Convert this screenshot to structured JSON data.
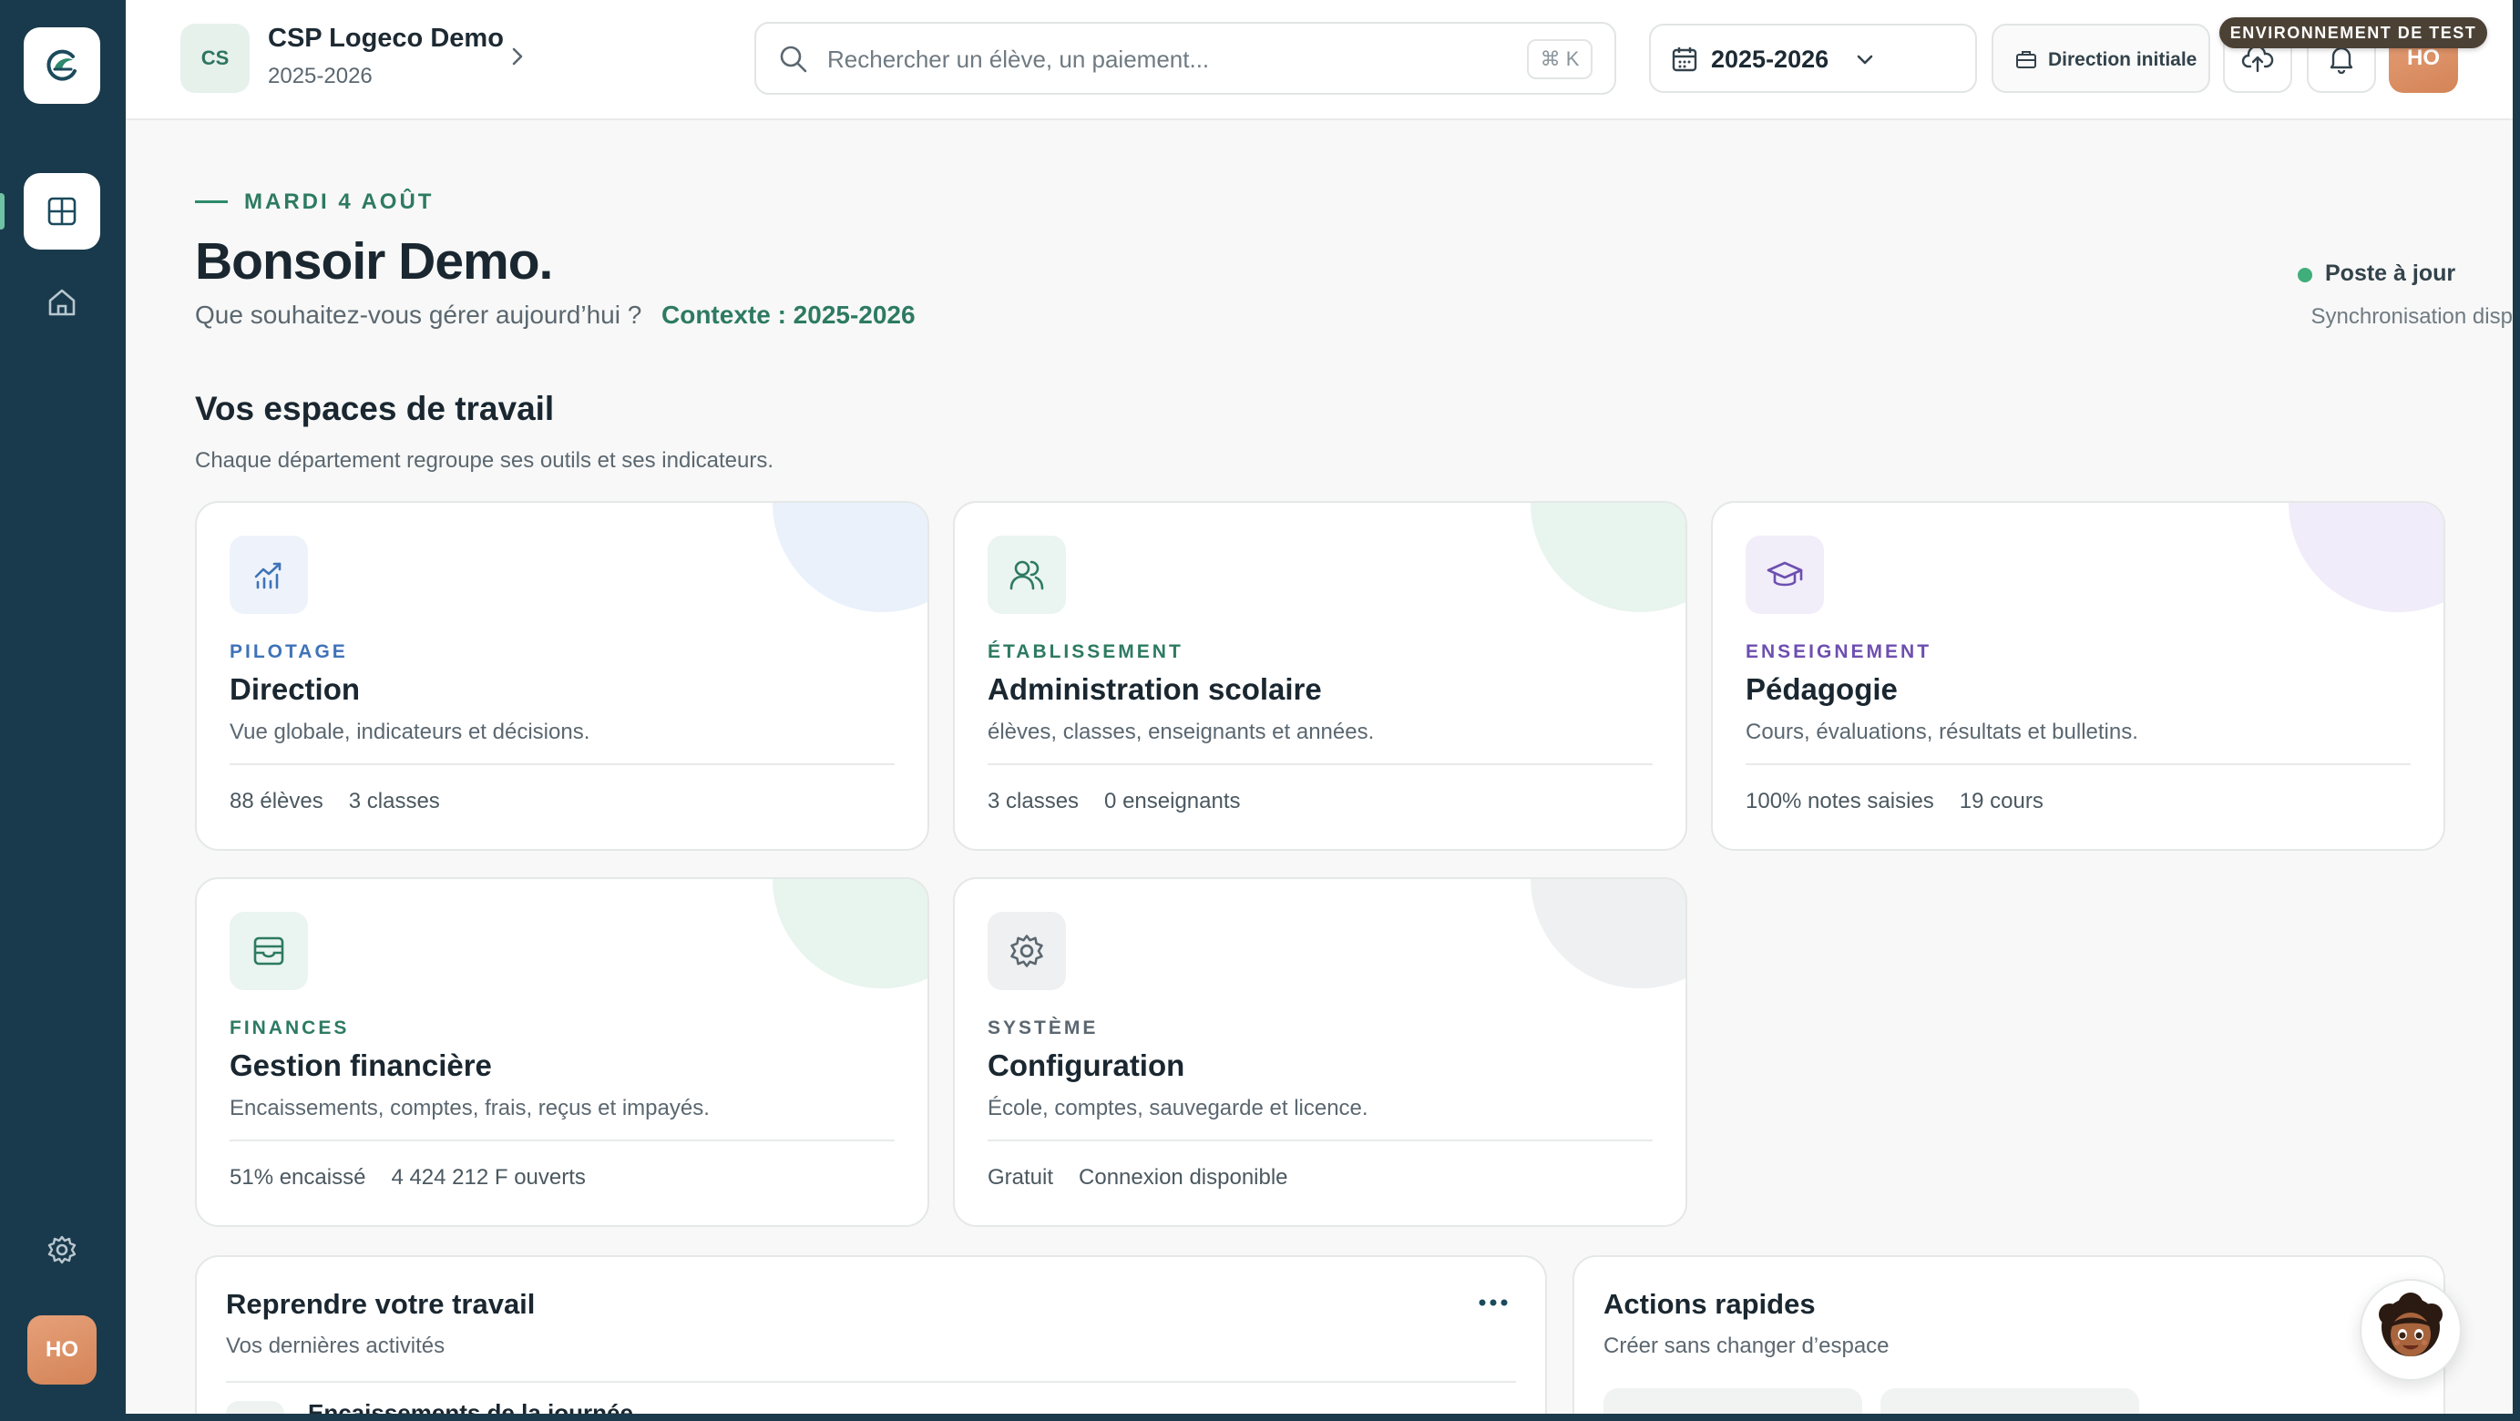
{
  "topbar": {
    "school_initials": "CS",
    "school_name": "CSP Logeco Demo",
    "school_year": "2025-2026",
    "search_placeholder": "Rechercher un élève, un paiement...",
    "search_shortcut": "⌘ K",
    "year_select": "2025-2026",
    "role_label": "Direction initiale",
    "avatar_initials": "HO",
    "env_badge": "ENVIRONNEMENT DE TEST"
  },
  "sidebar": {
    "avatar_initials": "HO",
    "items": [
      {
        "icon": "dashboard-icon",
        "active": true
      },
      {
        "icon": "home-icon",
        "active": false
      },
      {
        "icon": "gear-icon",
        "active": false
      }
    ]
  },
  "greeting": {
    "date": "MARDI 4 AOÛT",
    "title": "Bonsoir Demo.",
    "subtitle": "Que souhaitez-vous gérer aujourd’hui ?",
    "context": "Contexte : 2025-2026",
    "sync_status": "Poste à jour",
    "sync_sub": "Synchronisation disponible"
  },
  "workspaces": {
    "title": "Vos espaces de travail",
    "subtitle": "Chaque département regroupe ses outils et ses indicateurs.",
    "cards": [
      {
        "icon": "chart-icon",
        "category": "PILOTAGE",
        "name": "Direction",
        "desc": "Vue globale, indicateurs et décisions.",
        "stat1": "88 élèves",
        "stat2": "3 classes",
        "accent": "#3f73b8",
        "tint": "#eef3fb",
        "blob": "#eaf1fb"
      },
      {
        "icon": "users-icon",
        "category": "ÉTABLISSEMENT",
        "name": "Administration scolaire",
        "desc": "élèves, classes, enseignants et années.",
        "stat1": "3 classes",
        "stat2": "0 enseignants",
        "accent": "#2d7a62",
        "tint": "#eaf4f0",
        "blob": "#e8f4ee"
      },
      {
        "icon": "graduation-cap-icon",
        "category": "ENSEIGNEMENT",
        "name": "Pédagogie",
        "desc": "Cours, évaluations, résultats et bulletins.",
        "stat1": "100% notes saisies",
        "stat2": "19 cours",
        "accent": "#6d4fb0",
        "tint": "#f1edf9",
        "blob": "#f1ecf9"
      },
      {
        "icon": "wallet-icon",
        "category": "FINANCES",
        "name": "Gestion financière",
        "desc": "Encaissements, comptes, frais, reçus et impayés.",
        "stat1": "51% encaissé",
        "stat2": "4 424 212 F ouverts",
        "accent": "#2d7a62",
        "tint": "#eaf4f0",
        "blob": "#e8f4ee"
      },
      {
        "icon": "gear-icon",
        "category": "SYSTÈME",
        "name": "Configuration",
        "desc": "École, comptes, sauvegarde et licence.",
        "stat1": "Gratuit",
        "stat2": "Connexion disponible",
        "accent": "#5b6770",
        "tint": "#eef0f1",
        "blob": "#eef0f1"
      }
    ]
  },
  "resume": {
    "title": "Reprendre votre travail",
    "subtitle": "Vos dernières activités",
    "first_item": "Encaissements de la journée"
  },
  "quick_actions": {
    "title": "Actions rapides",
    "subtitle": "Créer sans changer d’espace"
  }
}
